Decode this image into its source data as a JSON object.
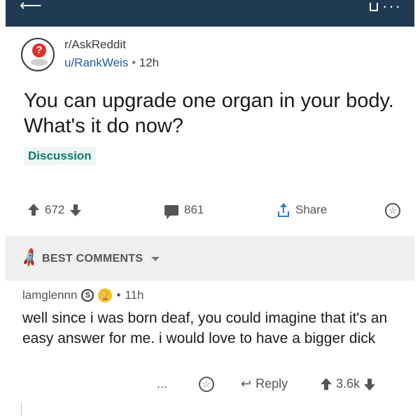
{
  "topbar": {
    "back_icon": "back-arrow-icon",
    "icons": [
      "bookmark-icon",
      "more-icon"
    ]
  },
  "post": {
    "subreddit": "r/AskReddit",
    "author": "u/RankWeis",
    "separator": "•",
    "age": "12h",
    "title": "You can upgrade one organ in your body. What's it do now?",
    "flair": "Discussion",
    "votes": "672",
    "comments": "861",
    "share_label": "Share"
  },
  "best_comments": {
    "label": "BEST COMMENTS"
  },
  "comment": {
    "author": "lamglennn",
    "badge_text": "S",
    "separator": "•",
    "age": "11h",
    "body": "well since i was born deaf, you could imagine that it's an easy answer for me. i would love to have a bigger dick",
    "more": "...",
    "reply_label": "Reply",
    "votes": "3.6k"
  },
  "colors": {
    "topbar": "#1f3a52",
    "link": "#1f5fa8",
    "flair": "#0a7c6c",
    "share": "#2a7bd8",
    "divider": "#efefef"
  }
}
